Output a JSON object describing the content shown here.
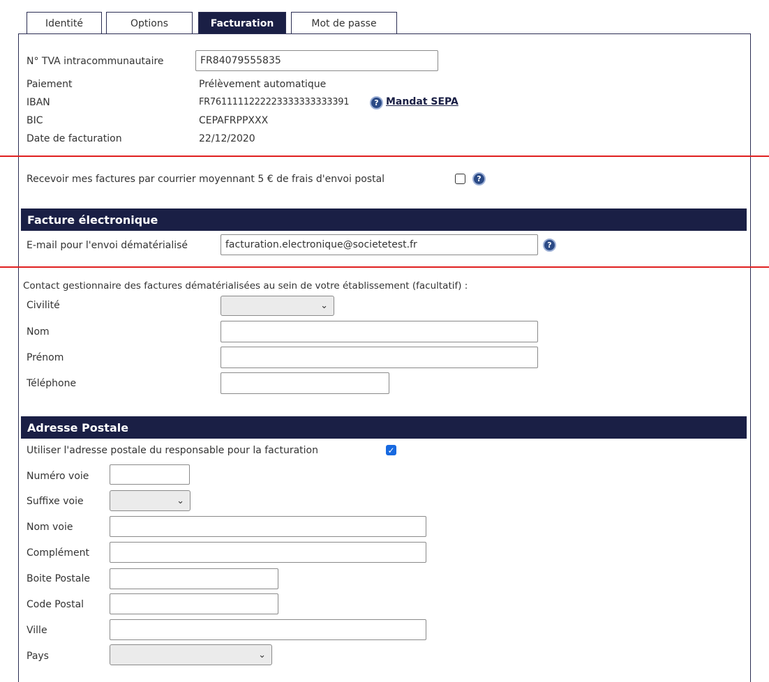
{
  "tabs": [
    {
      "label": "Identité"
    },
    {
      "label": "Options"
    },
    {
      "label": "Facturation"
    },
    {
      "label": "Mot de passe"
    }
  ],
  "billing": {
    "tva_label": "N° TVA intracommunautaire",
    "tva_value": "FR84079555835",
    "payment_label": "Paiement",
    "payment_value": "Prélèvement automatique",
    "iban_label": "IBAN",
    "iban_value": "FR7611111222223333333333391",
    "mandate_link": "Mandat SEPA",
    "bic_label": "BIC",
    "bic_value": "CEPAFRPPXXX",
    "date_label": "Date de facturation",
    "date_value": "22/12/2020",
    "postal_invoice_label": "Recevoir mes factures par courrier moyennant 5 € de frais d'envoi postal"
  },
  "electronic": {
    "header": "Facture électronique",
    "email_label": "E-mail pour l'envoi dématérialisé",
    "email_value": "facturation.electronique@societetest.fr"
  },
  "contact": {
    "intro": "Contact gestionnaire des factures dématérialisées au sein de votre établissement (facultatif) :",
    "civility_label": "Civilité",
    "lastname_label": "Nom",
    "firstname_label": "Prénom",
    "phone_label": "Téléphone"
  },
  "address": {
    "header": "Adresse Postale",
    "use_manager_label": "Utiliser l'adresse postale du responsable pour la facturation",
    "number_label": "Numéro voie",
    "suffix_label": "Suffixe voie",
    "street_label": "Nom voie",
    "complement_label": "Complément",
    "po_box_label": "Boite Postale",
    "zip_label": "Code Postal",
    "city_label": "Ville",
    "country_label": "Pays"
  },
  "icons": {
    "help": "question-circle-icon",
    "chevron": "chevron-down-icon"
  },
  "colors": {
    "navy": "#1a1f45",
    "checkbox_blue": "#1769e0",
    "red_marker": "#e02020"
  }
}
